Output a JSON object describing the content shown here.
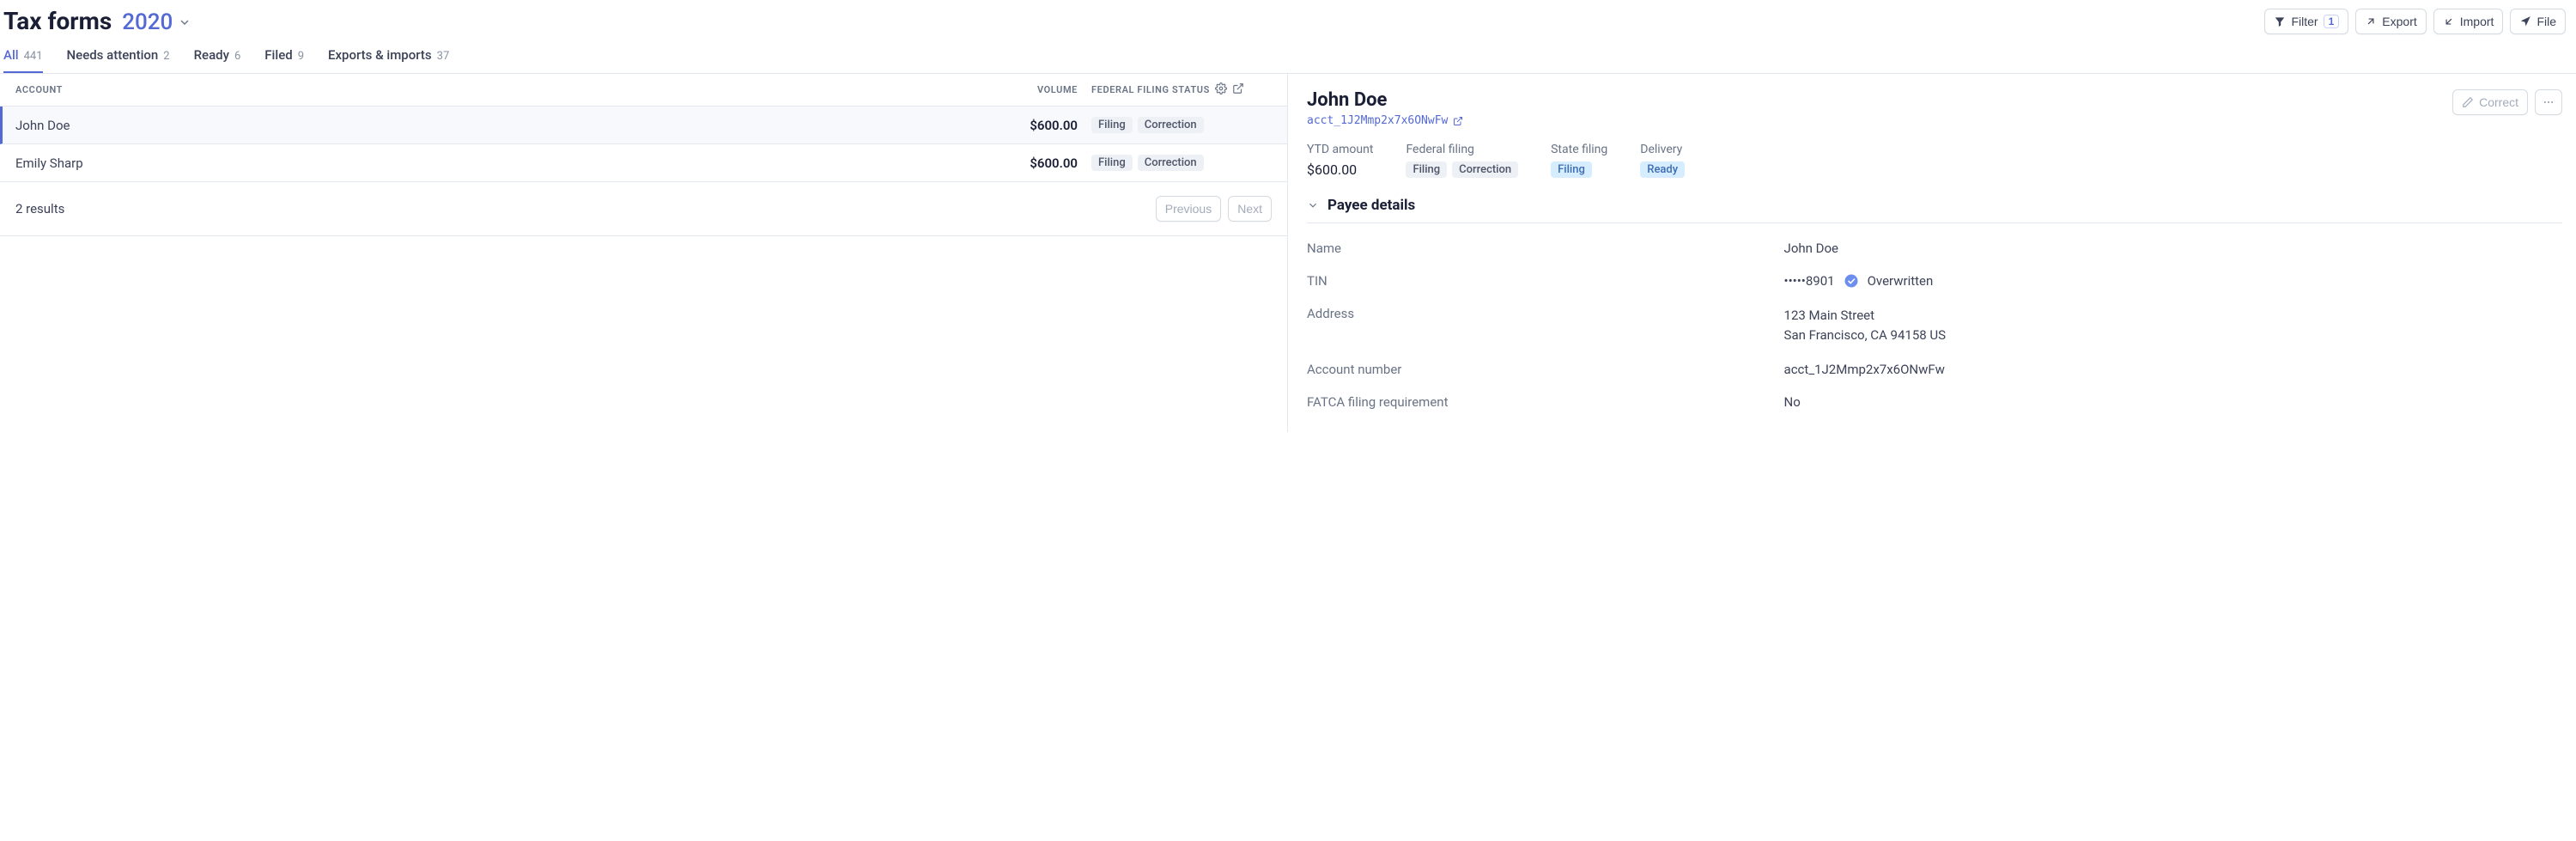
{
  "page_title": "Tax forms",
  "year": "2020",
  "header_actions": {
    "filter_label": "Filter",
    "filter_count": "1",
    "export_label": "Export",
    "import_label": "Import",
    "file_label": "File"
  },
  "tabs": [
    {
      "label": "All",
      "count": "441",
      "active": true
    },
    {
      "label": "Needs attention",
      "count": "2",
      "active": false
    },
    {
      "label": "Ready",
      "count": "6",
      "active": false
    },
    {
      "label": "Filed",
      "count": "9",
      "active": false
    },
    {
      "label": "Exports & imports",
      "count": "37",
      "active": false
    }
  ],
  "table": {
    "headers": {
      "account": "Account",
      "volume": "Volume",
      "status": "Federal filing status"
    },
    "rows": [
      {
        "name": "John Doe",
        "volume": "$600.00",
        "badges": [
          "Filing",
          "Correction"
        ],
        "selected": true
      },
      {
        "name": "Emily Sharp",
        "volume": "$600.00",
        "badges": [
          "Filing",
          "Correction"
        ],
        "selected": false
      }
    ],
    "results_text": "2 results",
    "previous_label": "Previous",
    "next_label": "Next"
  },
  "detail": {
    "name": "John Doe",
    "correct_label": "Correct",
    "account_id": "acct_1J2Mmp2x7x6ONwFw",
    "stats": {
      "ytd_label": "YTD amount",
      "ytd_value": "$600.00",
      "federal_label": "Federal filing",
      "federal_badges": [
        "Filing",
        "Correction"
      ],
      "state_label": "State filing",
      "state_badges": [
        "Filing"
      ],
      "delivery_label": "Delivery",
      "delivery_badges": [
        "Ready"
      ]
    },
    "section_title": "Payee details",
    "payee": {
      "name_label": "Name",
      "name_value": "John Doe",
      "tin_label": "TIN",
      "tin_value": "•••••8901",
      "tin_status": "Overwritten",
      "address_label": "Address",
      "address_line1": "123 Main Street",
      "address_line2": "San Francisco, CA 94158 US",
      "account_number_label": "Account number",
      "account_number_value": "acct_1J2Mmp2x7x6ONwFw",
      "fatca_label": "FATCA filing requirement",
      "fatca_value": "No"
    }
  }
}
